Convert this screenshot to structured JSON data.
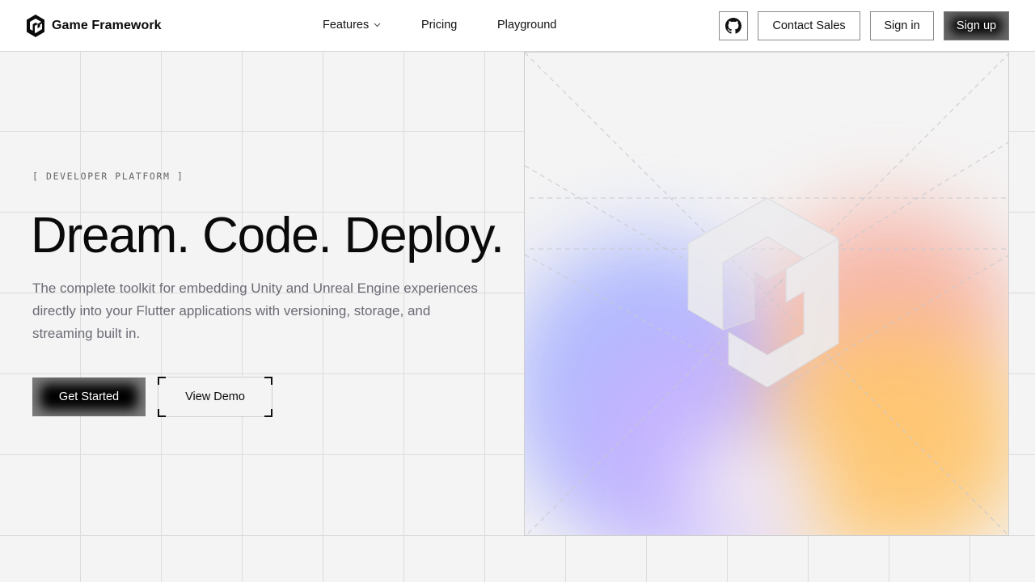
{
  "brand": {
    "name": "Game Framework",
    "logo_icon": "cube-logo-icon"
  },
  "nav": {
    "features": "Features",
    "pricing": "Pricing",
    "playground": "Playground"
  },
  "header_actions": {
    "github_icon": "github-icon",
    "contact": "Contact Sales",
    "signin": "Sign in",
    "signup": "Sign up"
  },
  "hero": {
    "eyebrow": "[ DEVELOPER PLATFORM ]",
    "headline": "Dream. Code. Deploy.",
    "subtitle": "The complete toolkit for embedding Unity and Unreal Engine experiences directly into your Flutter applications with versioning, storage, and streaming built in.",
    "primary_cta": "Get Started",
    "secondary_cta": "View Demo"
  },
  "colors": {
    "background": "#f4f4f4",
    "text": "#0b0b0b",
    "muted": "#6b6b75",
    "gradient_blue": "#a8b4ff",
    "gradient_violet": "#c7b2ff",
    "gradient_peach": "#f7a99a",
    "gradient_orange": "#ffc46a"
  }
}
